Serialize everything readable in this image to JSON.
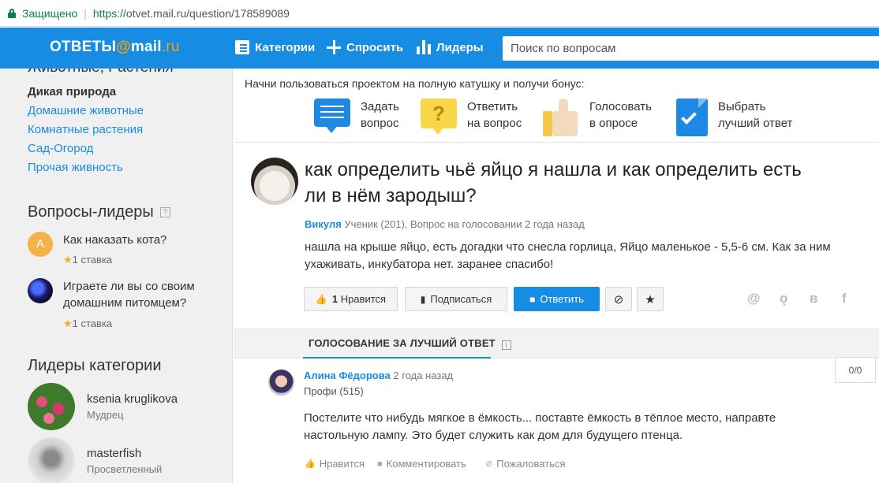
{
  "browser": {
    "secure_label": "Защищено",
    "url_scheme": "https://",
    "url_rest": "otvet.mail.ru/question/178589089"
  },
  "header": {
    "logo_main": "ОТВЕТЫ",
    "logo_at": "@",
    "logo_domain": "mail",
    "logo_tld": ".ru",
    "nav": {
      "categories": "Категории",
      "ask": "Спросить",
      "leaders": "Лидеры"
    },
    "search_placeholder": "Поиск по вопросам",
    "brand_color": "#168de2"
  },
  "sidebar": {
    "cut_heading": "Животные, Растения",
    "categories": [
      {
        "label": "Дикая природа",
        "active": true
      },
      {
        "label": "Домашние животные",
        "active": false
      },
      {
        "label": "Комнатные растения",
        "active": false
      },
      {
        "label": "Сад-Огород",
        "active": false
      },
      {
        "label": "Прочая живность",
        "active": false
      }
    ],
    "leader_questions_title": "Вопросы-лидеры",
    "leader_questions": [
      {
        "avatar_letter": "А",
        "text": "Как наказать кота?",
        "stake": "1 ставка"
      },
      {
        "text": "Играете ли вы со своим домашним питомцем?",
        "stake": "1 ставка"
      }
    ],
    "category_leaders_title": "Лидеры категории",
    "category_leaders": [
      {
        "name": "ksenia kruglikova",
        "rank": "Мудрец"
      },
      {
        "name": "masterfish",
        "rank": "Просветленный"
      }
    ]
  },
  "promo": {
    "heading": "Начни пользоваться проектом на полную катушку и получи бонус:",
    "items": [
      {
        "icon": "speech-bubble-icon",
        "line1": "Задать",
        "line2": "вопрос"
      },
      {
        "icon": "question-bubble-icon",
        "line1": "Ответить",
        "line2": "на вопрос"
      },
      {
        "icon": "thumbs-up-icon",
        "line1": "Голосовать",
        "line2": "в опросе"
      },
      {
        "icon": "checkmark-document-icon",
        "line1": "Выбрать",
        "line2": "лучший ответ"
      }
    ]
  },
  "question": {
    "title": "как определить чьё яйцо я нашла и как определить есть ли в нём зародыш?",
    "author": "Викуля",
    "meta": "Ученик (201), Вопрос на голосовании 2 года назад",
    "body": "нашла на крыше яйцо, есть догадки что снесла горлица, Яйцо маленькое - 5,5-6 см. Как за ним ухаживать, инкубатора нет. заранее спасибо!",
    "like_count": "1",
    "like_label": "Нравится",
    "subscribe_label": "Подписаться",
    "answer_label": "Ответить"
  },
  "tabs": {
    "voting": "ГОЛОСОВАНИЕ ЗА ЛУЧШИЙ ОТВЕТ"
  },
  "answer": {
    "author": "Алина Фёдорова",
    "time": "2 года назад",
    "rank": "Профи (515)",
    "body": "Постелите что нибудь мягкое в ёмкость... поставте ёмкость в тёплое место, направте настольную лампу. Это будет служить как дом для будущего птенца.",
    "like_label": "Нравится",
    "comment_label": "Комментировать",
    "complain_label": "Пожаловаться",
    "vote_count": "0/0"
  }
}
